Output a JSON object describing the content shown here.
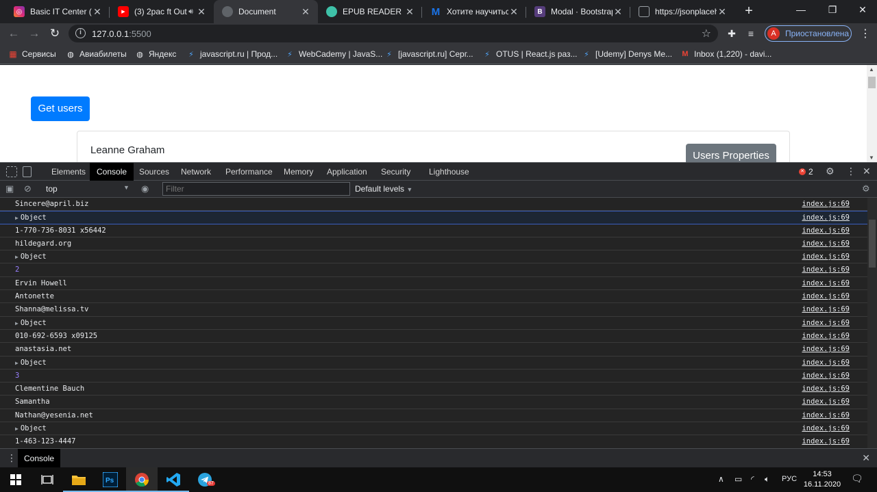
{
  "browser": {
    "tabs": [
      {
        "label": "Basic IT Center (@",
        "icon": "instagram-icon",
        "color": "#c13584",
        "active": false
      },
      {
        "label": "(3) 2pac ft Out",
        "icon": "youtube-icon",
        "color": "#ff0000",
        "active": false
      },
      {
        "label": "Document",
        "icon": "globe-icon",
        "color": "#5f6368",
        "active": true
      },
      {
        "label": "EPUB READER",
        "icon": "epub-icon",
        "color": "#34a853",
        "active": false
      },
      {
        "label": "Хотите научиться",
        "icon": "gmail-icon",
        "color": "#1a73e8",
        "active": false
      },
      {
        "label": "Modal · Bootstrap",
        "icon": "bootstrap-icon",
        "color": "#563d7c",
        "active": false
      },
      {
        "label": "https://jsonplaceh",
        "icon": "page-icon",
        "color": "#5f6368",
        "active": false
      }
    ],
    "url_host": "127.0.0.1",
    "url_port": ":5500",
    "profile_initial": "А",
    "profile_status": "Приостановлена",
    "bookmarks": [
      {
        "label": "Сервисы",
        "icon": "apps-icon"
      },
      {
        "label": "Авиабилеты",
        "icon": "globe-icon"
      },
      {
        "label": "Яндекс",
        "icon": "globe-icon"
      },
      {
        "label": "javascript.ru | Прод...",
        "icon": "jsru-icon"
      },
      {
        "label": "WebCademy | JavaS...",
        "icon": "jsru-icon"
      },
      {
        "label": "[javascript.ru] Серг...",
        "icon": "jsru-icon"
      },
      {
        "label": "OTUS | React.js раз...",
        "icon": "jsru-icon"
      },
      {
        "label": "[Udemy] Denys Me...",
        "icon": "jsru-icon"
      },
      {
        "label": "Inbox (1,220) - davi...",
        "icon": "gmail-icon"
      }
    ]
  },
  "page": {
    "get_users_label": "Get users",
    "card_name": "Leanne Graham",
    "users_properties_label": "Users Properties"
  },
  "devtools": {
    "tabs": [
      "Elements",
      "Console",
      "Sources",
      "Network",
      "Performance",
      "Memory",
      "Application",
      "Security",
      "Lighthouse"
    ],
    "active_tab": "Console",
    "error_count": "2",
    "context": "top",
    "filter_placeholder": "Filter",
    "levels": "Default levels",
    "drawer_tab": "Console",
    "console_rows": [
      {
        "text": "Sincere@april.biz",
        "src": "index.js:69",
        "kind": "str"
      },
      {
        "text": "Object",
        "src": "index.js:69",
        "kind": "obj"
      },
      {
        "text": "1-770-736-8031 x56442",
        "src": "index.js:69",
        "kind": "str"
      },
      {
        "text": "hildegard.org",
        "src": "index.js:69",
        "kind": "str"
      },
      {
        "text": "Object",
        "src": "index.js:69",
        "kind": "obj"
      },
      {
        "text": "2",
        "src": "index.js:69",
        "kind": "num"
      },
      {
        "text": "Ervin Howell",
        "src": "index.js:69",
        "kind": "str"
      },
      {
        "text": "Antonette",
        "src": "index.js:69",
        "kind": "str"
      },
      {
        "text": "Shanna@melissa.tv",
        "src": "index.js:69",
        "kind": "str"
      },
      {
        "text": "Object",
        "src": "index.js:69",
        "kind": "obj"
      },
      {
        "text": "010-692-6593 x09125",
        "src": "index.js:69",
        "kind": "str"
      },
      {
        "text": "anastasia.net",
        "src": "index.js:69",
        "kind": "str"
      },
      {
        "text": "Object",
        "src": "index.js:69",
        "kind": "obj"
      },
      {
        "text": "3",
        "src": "index.js:69",
        "kind": "num"
      },
      {
        "text": "Clementine Bauch",
        "src": "index.js:69",
        "kind": "str"
      },
      {
        "text": "Samantha",
        "src": "index.js:69",
        "kind": "str"
      },
      {
        "text": "Nathan@yesenia.net",
        "src": "index.js:69",
        "kind": "str"
      },
      {
        "text": "Object",
        "src": "index.js:69",
        "kind": "obj"
      },
      {
        "text": "1-463-123-4447",
        "src": "index.js:69",
        "kind": "str"
      }
    ]
  },
  "taskbar": {
    "items": [
      {
        "name": "windows-start-icon"
      },
      {
        "name": "task-view-icon"
      },
      {
        "name": "file-explorer-icon"
      },
      {
        "name": "photoshop-icon"
      },
      {
        "name": "chrome-icon"
      },
      {
        "name": "vscode-icon"
      },
      {
        "name": "telegram-icon",
        "badge": "87"
      }
    ],
    "language": "РУС",
    "time": "14:53",
    "date": "16.11.2020"
  }
}
